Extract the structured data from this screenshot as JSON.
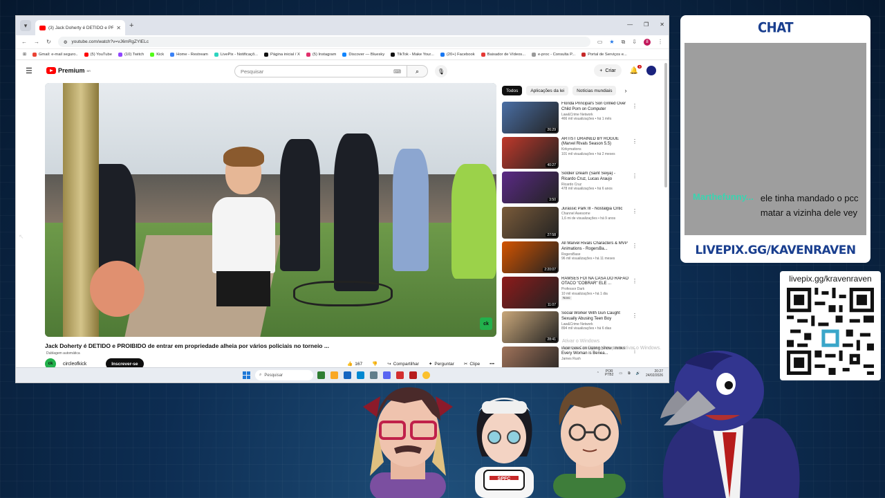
{
  "browser": {
    "tab_title": "(3) Jack Doherty é DETIDO e PR...",
    "url": "youtube.com/watch?v=vJ6mRgZYlELc",
    "bookmarks": [
      {
        "label": "Gmail: e-mail seguro..",
        "color": "#ea4335"
      },
      {
        "label": "(5) YouTube",
        "color": "#ff0000"
      },
      {
        "label": "(10) Twitch",
        "color": "#9146ff"
      },
      {
        "label": "Kick",
        "color": "#53fc18"
      },
      {
        "label": "Home - Restream",
        "color": "#3b82f6"
      },
      {
        "label": "LivePix - Notificaçõ...",
        "color": "#2dd4bf"
      },
      {
        "label": "Página inicial / X",
        "color": "#111111"
      },
      {
        "label": "(5) Instagram",
        "color": "#e1306c"
      },
      {
        "label": "Discover — Bluesky",
        "color": "#1185fe"
      },
      {
        "label": "TikTok - Make Your...",
        "color": "#111111"
      },
      {
        "label": "(20+) Facebook",
        "color": "#1877f2"
      },
      {
        "label": "Baixador de Vídeos...",
        "color": "#e53935"
      },
      {
        "label": "e-proc - Consulta P...",
        "color": "#999999"
      },
      {
        "label": "Portal de Serviços e...",
        "color": "#c62828"
      }
    ]
  },
  "youtube": {
    "logo": "Premium",
    "logo_sup": "BR",
    "search_placeholder": "Pesquisar",
    "create_label": "Criar",
    "notif_count": "9",
    "video_title": "Jack Doherty é DETIDO e PROIBIDO de entrar em propriedade alheia por vários policiais no torneio ...",
    "dub_label": "Dublagem automática",
    "channel_initials": "ck",
    "channel_name": "circleofkick",
    "subscribe_label": "Inscrever-se",
    "likes": "167",
    "share_label": "Compartilhar",
    "ask_label": "Perguntar",
    "clip_label": "Clipe",
    "video_badge": "ck",
    "chips": [
      "Todos",
      "Aplicações da lei",
      "Notícias mundiais"
    ],
    "recommendations": [
      {
        "title": "Florida Principal's Son Grilled Over Child Porn on Computer",
        "channel": "Law&Crime Network",
        "stats": "466 mil visualizações • há 1 mês",
        "duration": "26:29",
        "color": "#4a6fa5",
        "badge": ""
      },
      {
        "title": "ARTIST DRAINED BY ROGUE (Marvel Rivals Season 5.5)",
        "channel": "Kirkymations",
        "stats": "101 mil visualizações • há 2 meses",
        "duration": "40:27",
        "color": "#c0392b",
        "badge": ""
      },
      {
        "title": "Soldier Dream (Saint Seiya) - Ricardo Cruz, Lucas Araujo",
        "channel": "Ricardo Cruz",
        "stats": "478 mil visualizações • há 6 anos",
        "duration": "3:50",
        "color": "#5b2a86",
        "badge": ""
      },
      {
        "title": "Jurassic Park III - Nostalgia Critic",
        "channel": "Channel Awesome",
        "stats": "1,6 mi de visualizações • há 9 anos",
        "duration": "27:58",
        "color": "#7a5b3a",
        "badge": ""
      },
      {
        "title": "All Marvel Rivals Characters & MVP Animations - RogersBa...",
        "channel": "RogersBase",
        "stats": "96 mil visualizações • há 11 meses",
        "duration": "2:20:07",
        "color": "#d35400",
        "badge": ""
      },
      {
        "title": "RAMSES FOI NA CASA DO RAFAO OTACO \"COBRAR\" ELE ...",
        "channel": "Professor Dark",
        "stats": "10 mil visualizações • há 1 dia",
        "duration": "11:07",
        "color": "#8e1b1b",
        "badge": "Novo"
      },
      {
        "title": "Social Worker With Gun Caught Sexually Abusing Teen Boy",
        "channel": "Law&Crime Network",
        "stats": "894 mil visualizações • há 6 dias",
        "duration": "28:41",
        "color": "#c9a77a",
        "badge": ""
      },
      {
        "title": "Incel Goes on Dating Show Thinks Every Woman is Benea...",
        "channel": "James Rush",
        "stats": "",
        "duration": "",
        "color": "#a0735a",
        "badge": ""
      }
    ],
    "watermark_line1": "Ativar o Windows",
    "watermark_line2": "Acesse Configurações para ativar o Windows."
  },
  "taskbar": {
    "search_placeholder": "Pesquisar",
    "lang1": "POR",
    "lang2": "PTB2",
    "time": "20:27",
    "date": "24/02/2026"
  },
  "chat": {
    "title": "CHAT",
    "user": "Marthefunny...",
    "message": "ele tinha mandado o pcc matar a vizinha dele vey",
    "footer": "LIVEPIX.GG/KAVENRAVEN"
  },
  "qr": {
    "url": "livepix.gg/kravenraven"
  },
  "colors": {
    "brand_blue": "#1a3f8f",
    "youtube_red": "#ff0000",
    "chat_user": "#3ad4b0"
  }
}
